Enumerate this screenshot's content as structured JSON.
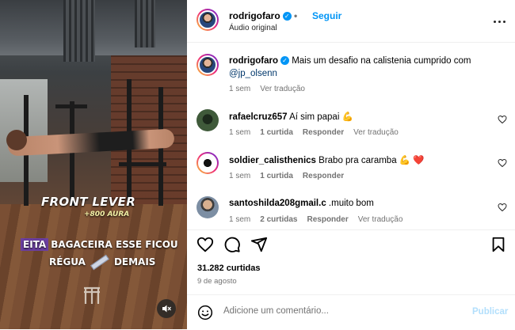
{
  "post": {
    "author": "rodrigofaro",
    "separator": "•",
    "follow_label": "Seguir",
    "audio": "Áudio original",
    "more_menu": "more-options"
  },
  "video": {
    "overlay_title": "FRONT LEVER",
    "overlay_aura": "+800 AURA",
    "caption_highlight": "EITA",
    "caption_line1": "BAGACEIRA ESSE FICOU",
    "caption_line2a": "RÉGUA",
    "caption_line2b": "DEMAIS",
    "mute_icon": "speaker-muted-icon"
  },
  "caption": {
    "author": "rodrigofaro",
    "text": "Mais um desafio na calistenia cumprido com",
    "mention": "@jp_olsenn",
    "time": "1 sem",
    "translate": "Ver tradução"
  },
  "comments": [
    {
      "user": "rafaelcruz657",
      "text": "Aí sim papai 💪",
      "time": "1 sem",
      "likes": "1 curtida",
      "reply": "Responder",
      "translate": "Ver tradução"
    },
    {
      "user": "soldier_calisthenics",
      "text": "Brabo pra caramba 💪 ❤️",
      "time": "1 sem",
      "likes": "1 curtida",
      "reply": "Responder"
    },
    {
      "user": "santoshilda208gmail.c",
      "text": ".muito bom",
      "time": "1 sem",
      "likes": "2 curtidas",
      "reply": "Responder",
      "translate": "Ver tradução"
    }
  ],
  "actions": {
    "likes": "31.282 curtidas",
    "date": "9 de agosto"
  },
  "composer": {
    "placeholder": "Adicione um comentário...",
    "publish": "Publicar"
  },
  "colors": {
    "accent": "#0095f6",
    "publish_disabled": "#b2dffc",
    "highlight": "#6b3fa0"
  }
}
